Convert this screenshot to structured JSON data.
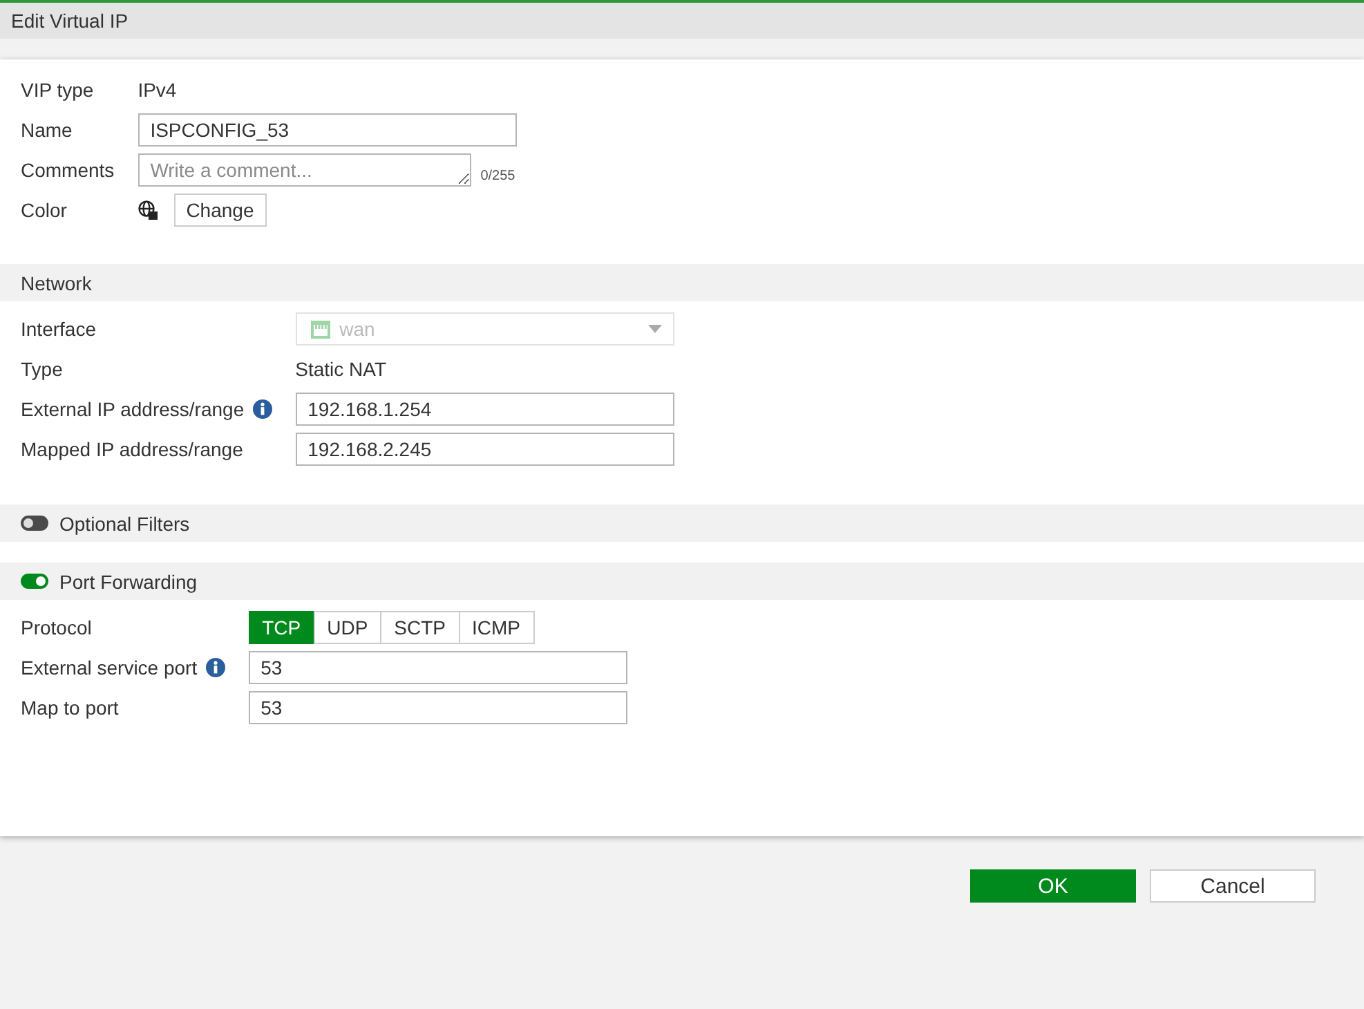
{
  "window": {
    "title": "Edit Virtual IP"
  },
  "general": {
    "fields": [
      {
        "kind": "text",
        "label": "VIP type",
        "value": "IPv4"
      },
      {
        "kind": "input",
        "label": "Name",
        "value": "ISPCONFIG_53"
      },
      {
        "kind": "textarea",
        "label": "Comments",
        "placeholder": "Write a comment...",
        "counter": "0/255"
      },
      {
        "kind": "color",
        "label": "Color",
        "button": "Change"
      }
    ]
  },
  "sections": [
    {
      "title": "Network",
      "fields": [
        {
          "kind": "select",
          "label": "Interface",
          "value": "wan",
          "disabled": true,
          "info": false
        },
        {
          "kind": "text",
          "label": "Type",
          "value": "Static NAT",
          "info": false
        },
        {
          "kind": "input",
          "label": "External IP address/range",
          "value": "192.168.1.254",
          "info": true
        },
        {
          "kind": "input",
          "label": "Mapped IP address/range",
          "value": "192.168.2.245",
          "info": false
        }
      ]
    },
    {
      "title": "Optional Filters",
      "on": false
    },
    {
      "title": "Port Forwarding",
      "on": true,
      "fields": [
        {
          "kind": "segmented",
          "label": "Protocol",
          "info": false,
          "options": [
            {
              "label": "TCP",
              "selected": true
            },
            {
              "label": "UDP",
              "selected": false
            },
            {
              "label": "SCTP",
              "selected": false
            },
            {
              "label": "ICMP",
              "selected": false
            }
          ]
        },
        {
          "kind": "input",
          "label": "External service port",
          "value": "53",
          "info": true
        },
        {
          "kind": "input",
          "label": "Map to port",
          "value": "53",
          "info": false
        }
      ]
    }
  ],
  "buttons": [
    {
      "kind": "primary",
      "label": "OK"
    },
    {
      "kind": "secondary",
      "label": "Cancel"
    }
  ]
}
